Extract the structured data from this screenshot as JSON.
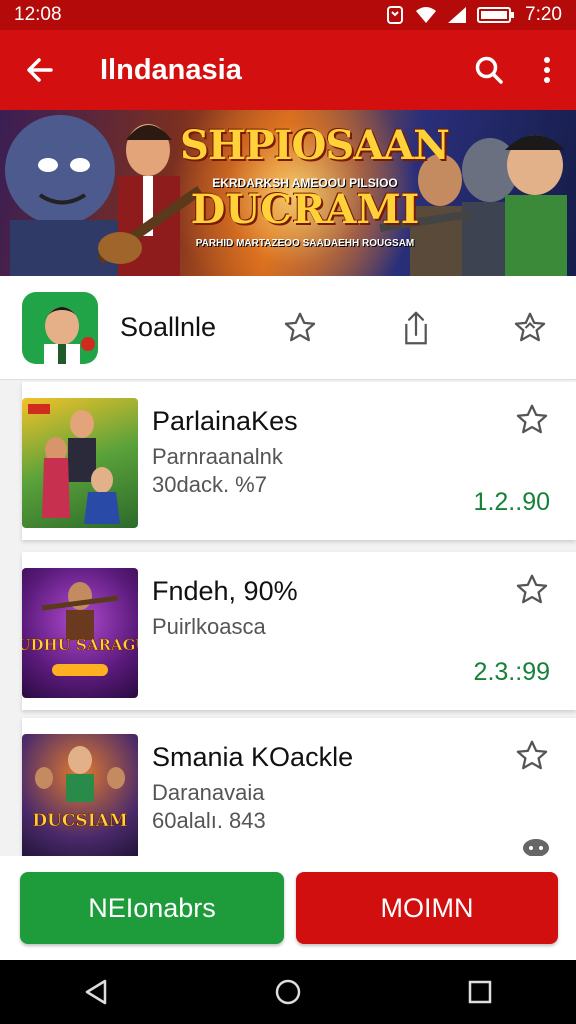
{
  "status": {
    "time_left": "12:08",
    "time_right": "7:20"
  },
  "app_bar": {
    "title": "Ilndanasia"
  },
  "banner": {
    "title_line1": "SHPIOSAAN",
    "subtitle": "EKRDARKSH AMEOOU PILSIOO",
    "title_line2": "DUCRAMI",
    "caption": "PARHID MARTAZEOO SAADAEHH ROUGSAM"
  },
  "header": {
    "name": "Soallnle"
  },
  "items": [
    {
      "title": "ParlainaKes",
      "subtitle": "Parnraanalnk",
      "meta": "30dack. %7",
      "price": "1.2..90"
    },
    {
      "title": "Fndeh, 90%",
      "subtitle": "Puirlkoasca",
      "meta": "",
      "price": "2.3.:99"
    },
    {
      "title": "Smania KOackle",
      "subtitle": "Daranavaia",
      "meta": "60alalı. 843",
      "price": ""
    }
  ],
  "thumb_texts": {
    "second": "SAUDHU SARAGUM",
    "third": "DUCSIAM"
  },
  "actions": {
    "primary": "NEIonabrs",
    "secondary": "MOIMN"
  },
  "colors": {
    "brand_red": "#d40f0f",
    "status_red": "#b50a0a",
    "price_green": "#17813a",
    "button_green": "#1e9c3c"
  },
  "icons": [
    "back-arrow-icon",
    "search-icon",
    "more-vertical-icon",
    "star-outline-icon",
    "share-icon",
    "star-badge-icon",
    "chat-bubble-icon",
    "nav-back-icon",
    "nav-home-icon",
    "nav-recents-icon"
  ]
}
